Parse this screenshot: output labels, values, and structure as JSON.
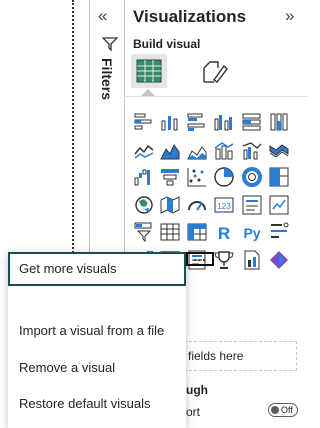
{
  "canvas": {
    "divider": "dotted-border"
  },
  "filters_pane": {
    "collapse_icon": "chevron-double-left-icon",
    "filter_icon": "funnel-icon",
    "label": "Filters"
  },
  "viz_pane": {
    "title": "Visualizations",
    "collapse_icon": "chevron-double-right-icon",
    "build_visual_label": "Build visual",
    "tabs": [
      "table-grid-icon",
      "format-paintbrush-icon"
    ],
    "visual_icons": [
      "stacked-bar-chart-icon",
      "stacked-column-chart-icon",
      "clustered-bar-chart-icon",
      "clustered-column-chart-icon",
      "100-stacked-bar-chart-icon",
      "100-stacked-column-chart-icon",
      "line-chart-icon",
      "area-chart-icon",
      "stacked-area-chart-icon",
      "line-and-column-chart-icon",
      "line-and-clustered-column-chart-icon",
      "ribbon-chart-icon",
      "waterfall-chart-icon",
      "funnel-chart-icon",
      "scatter-chart-icon",
      "pie-chart-icon",
      "donut-chart-icon",
      "treemap-icon",
      "map-icon",
      "filled-map-icon",
      "gauge-icon",
      "card-icon",
      "multi-row-card-icon",
      "kpi-icon",
      "slicer-icon",
      "table-icon",
      "matrix-icon",
      "r-visual-icon",
      "python-visual-icon",
      "key-influencers-icon",
      "decomposition-tree-icon",
      "qa-icon",
      "smart-narrative-icon",
      "metrics-icon",
      "paginated-report-icon",
      "power-apps-icon"
    ],
    "more_options": "...",
    "drop_zone": "fields here",
    "fragment_1": "ugh",
    "fragment_2": "ort",
    "toggle_label": "Off"
  },
  "context_menu": {
    "items": [
      "Get more visuals",
      "Import a visual from a file",
      "Remove a visual",
      "Restore default visuals"
    ]
  },
  "colors": {
    "accent": "#1b4f4b",
    "icon_blue": "#2b7cd3",
    "icon_teal": "#118dff",
    "text": "#252423"
  }
}
